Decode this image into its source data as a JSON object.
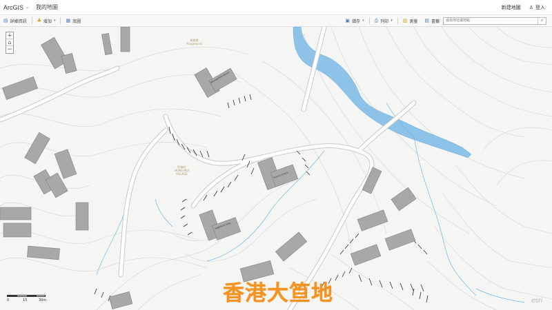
{
  "topbar": {
    "app_name": "ArcGIS",
    "map_title": "我的地圖",
    "new_map_label": "新建地圖",
    "sign_in_label": "登入"
  },
  "toolbar": {
    "details_label": "詳細資訊",
    "add_label": "增加",
    "basemap_label": "底圖",
    "save_label": "儲存",
    "print_label": "列印",
    "measure_label": "測量",
    "bookmarks_label": "書籤",
    "search_placeholder": "尋找地址或地點"
  },
  "zoom": {
    "zoom_in": "+",
    "home": "⌂",
    "zoom_out": "−"
  },
  "map": {
    "place_labels": [
      {
        "text": "遊樂場\nPlayground"
      },
      {
        "text": "紅梅村\nHUNG MUI\nVILLAGE"
      }
    ],
    "building_labels": [
      "Wonderfull House",
      "Sunny Court",
      "Highland Villa"
    ]
  },
  "scalebar": {
    "labels": [
      "0",
      "15",
      "30m"
    ]
  },
  "watermark": "香港大笪地",
  "esri_logo": "esri",
  "colors": {
    "building_fill": "#a8a8a8",
    "building_stroke": "#7f7f7f",
    "river": "#8dc3e8",
    "contour": "#cfcfcf",
    "road": "#ffffff",
    "stream": "#6fb7e0",
    "watermark": "#f39322"
  }
}
